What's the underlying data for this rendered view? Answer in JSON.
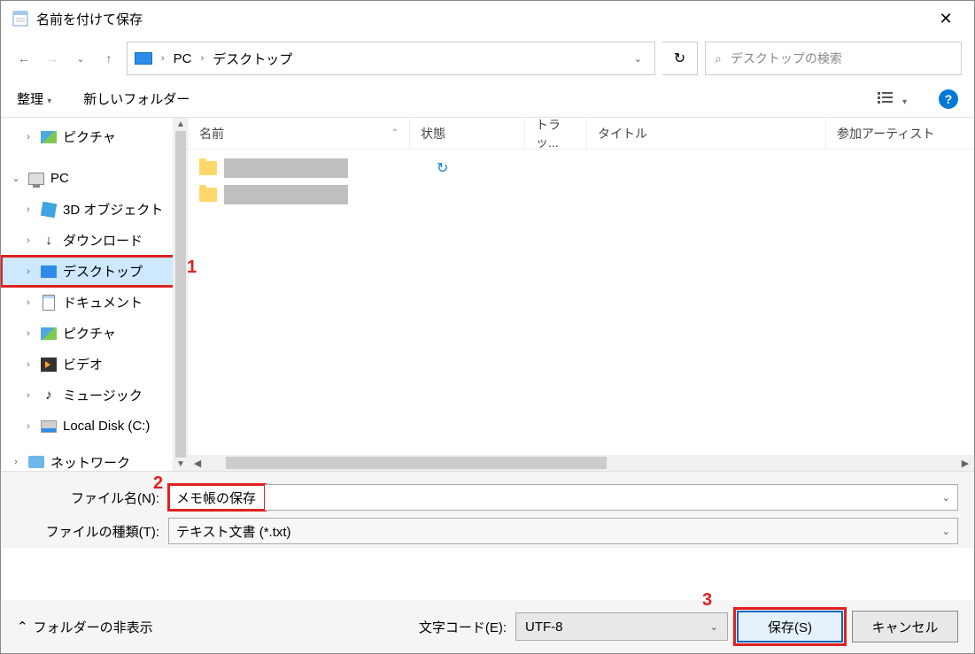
{
  "window": {
    "title": "名前を付けて保存"
  },
  "nav": {
    "path": {
      "pc": "PC",
      "folder": "デスクトップ"
    },
    "search_placeholder": "デスクトップの検索"
  },
  "toolbar": {
    "organize": "整理",
    "new_folder": "新しいフォルダー",
    "viewmenu_icon": "list-view-icon"
  },
  "tree": {
    "items": [
      {
        "label": "ピクチャ",
        "indent": 1,
        "expand": ">",
        "icon": "img"
      },
      {
        "label": null,
        "spacer": true
      },
      {
        "label": "PC",
        "indent": 0,
        "expand": "v",
        "icon": "pc"
      },
      {
        "label": "3D オブジェクト",
        "indent": 1,
        "expand": ">",
        "icon": "cube"
      },
      {
        "label": "ダウンロード",
        "indent": 1,
        "expand": ">",
        "icon": "dl"
      },
      {
        "label": "デスクトップ",
        "indent": 1,
        "expand": ">",
        "icon": "desk",
        "selected": true,
        "boxed": true
      },
      {
        "label": "ドキュメント",
        "indent": 1,
        "expand": ">",
        "icon": "doc"
      },
      {
        "label": "ピクチャ",
        "indent": 1,
        "expand": ">",
        "icon": "img"
      },
      {
        "label": "ビデオ",
        "indent": 1,
        "expand": ">",
        "icon": "vid"
      },
      {
        "label": "ミュージック",
        "indent": 1,
        "expand": ">",
        "icon": "music"
      },
      {
        "label": "Local Disk (C:)",
        "indent": 1,
        "expand": ">",
        "icon": "disk"
      },
      {
        "label": null,
        "spacer": true
      },
      {
        "label": "ネットワーク",
        "indent": 0,
        "expand": ">",
        "icon": "net",
        "cut": true
      }
    ]
  },
  "columns": {
    "name": "名前",
    "status": "状態",
    "track": "トラッ...",
    "title": "タイトル",
    "artist": "参加アーティスト"
  },
  "form": {
    "filename_label": "ファイル名(N):",
    "filename_value": "メモ帳の保存",
    "filetype_label": "ファイルの種類(T):",
    "filetype_value": "テキスト文書 (*.txt)"
  },
  "bottom": {
    "hide_folders": "フォルダーの非表示",
    "encoding_label": "文字コード(E):",
    "encoding_value": "UTF-8",
    "save": "保存(S)",
    "cancel": "キャンセル"
  },
  "annotations": {
    "a1": "1",
    "a2": "2",
    "a3": "3"
  }
}
